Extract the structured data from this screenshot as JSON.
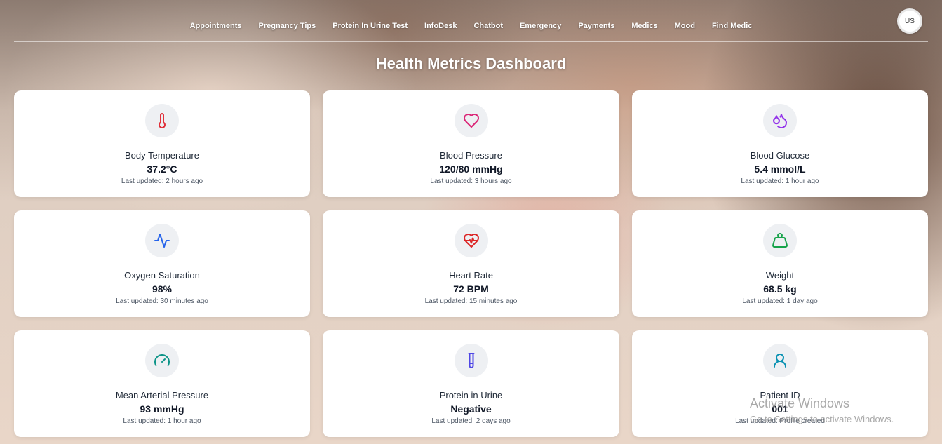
{
  "nav": {
    "links": [
      "Appointments",
      "Pregnancy Tips",
      "Protein In Urine Test",
      "InfoDesk",
      "Chatbot",
      "Emergency",
      "Payments",
      "Medics",
      "Mood",
      "Find Medic"
    ],
    "avatar_initials": "US"
  },
  "page_title": "Health Metrics Dashboard",
  "cards": [
    {
      "label": "Body Temperature",
      "value": "37.2°C",
      "updated": "Last updated: 2 hours ago",
      "icon": "thermometer-icon",
      "color": "#e0303a"
    },
    {
      "label": "Blood Pressure",
      "value": "120/80 mmHg",
      "updated": "Last updated: 3 hours ago",
      "icon": "heart-icon",
      "color": "#db2777"
    },
    {
      "label": "Blood Glucose",
      "value": "5.4 mmol/L",
      "updated": "Last updated: 1 hour ago",
      "icon": "droplets-icon",
      "color": "#9333ea"
    },
    {
      "label": "Oxygen Saturation",
      "value": "98%",
      "updated": "Last updated: 30 minutes ago",
      "icon": "activity-icon",
      "color": "#2563eb"
    },
    {
      "label": "Heart Rate",
      "value": "72 BPM",
      "updated": "Last updated: 15 minutes ago",
      "icon": "heart-pulse-icon",
      "color": "#dc2626"
    },
    {
      "label": "Weight",
      "value": "68.5 kg",
      "updated": "Last updated: 1 day ago",
      "icon": "weight-icon",
      "color": "#16a34a"
    },
    {
      "label": "Mean Arterial Pressure",
      "value": "93 mmHg",
      "updated": "Last updated: 1 hour ago",
      "icon": "gauge-icon",
      "color": "#0d9488"
    },
    {
      "label": "Protein in Urine",
      "value": "Negative",
      "updated": "Last updated: 2 days ago",
      "icon": "test-tube-icon",
      "color": "#4f46e5"
    },
    {
      "label": "Patient ID",
      "value": "001",
      "updated": "Last updated: Profile created",
      "icon": "user-icon",
      "color": "#0891b2"
    }
  ],
  "watermark": {
    "title": "Activate Windows",
    "subtitle": "Go to Settings to activate Windows."
  }
}
